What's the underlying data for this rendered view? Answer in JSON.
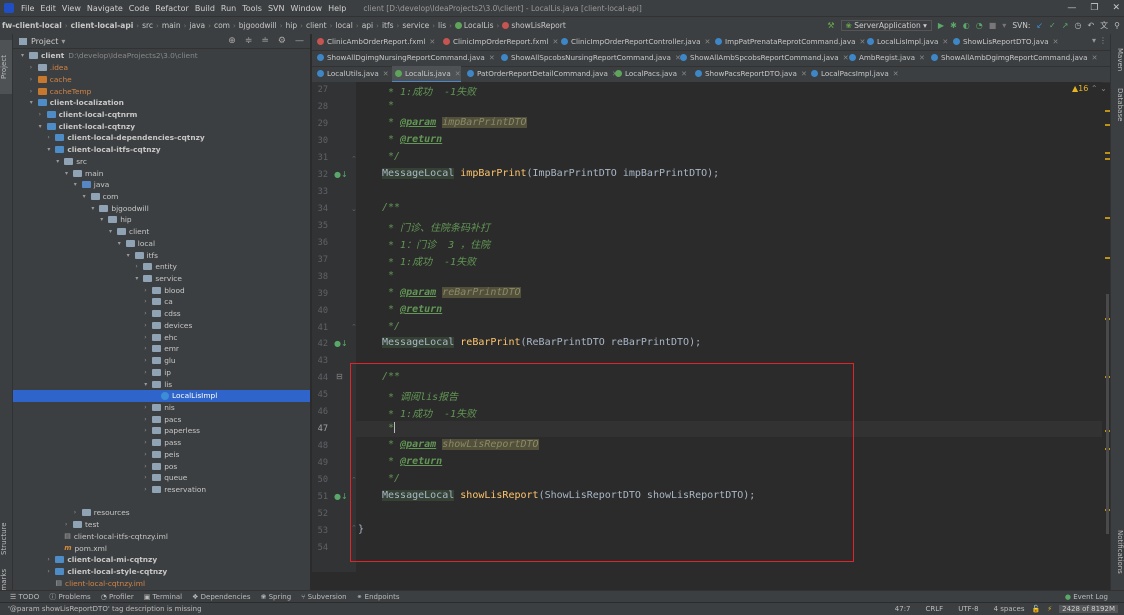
{
  "menubar": {
    "items": [
      "File",
      "Edit",
      "View",
      "Navigate",
      "Code",
      "Refactor",
      "Build",
      "Run",
      "Tools",
      "SVN",
      "Window",
      "Help"
    ],
    "window_title": "client [D:\\develop\\IdeaProjects2\\3.0\\client] - LocalLis.java [client-local-api]"
  },
  "navbar": {
    "crumbs": [
      "fw-client-local",
      "client-local-api",
      "src",
      "main",
      "java",
      "com",
      "bjgoodwill",
      "hip",
      "client",
      "local",
      "api",
      "itfs",
      "service",
      "lis",
      "LocalLis",
      "showLisReport"
    ],
    "run_config": "ServerApplication",
    "svn_label": "SVN:"
  },
  "project": {
    "title": "Project",
    "tree": [
      {
        "label": "client",
        "extra": "D:\\develop\\IdeaProjects2\\3.0\\client",
        "indent": 0,
        "arrow": "▾",
        "icon": "folder",
        "style": "bold"
      },
      {
        "label": ".idea",
        "indent": 1,
        "arrow": "›",
        "icon": "folder",
        "style": "orange"
      },
      {
        "label": "cache",
        "indent": 1,
        "arrow": "›",
        "icon": "folder orange",
        "style": "orange"
      },
      {
        "label": "cacheTemp",
        "indent": 1,
        "arrow": "›",
        "icon": "folder orange",
        "style": "orange"
      },
      {
        "label": "client-localization",
        "indent": 1,
        "arrow": "▾",
        "icon": "folder blue",
        "style": "bold"
      },
      {
        "label": "client-local-cqtnrm",
        "indent": 2,
        "arrow": "›",
        "icon": "folder blue",
        "style": "bold"
      },
      {
        "label": "client-local-cqtnzy",
        "indent": 2,
        "arrow": "▾",
        "icon": "folder blue",
        "style": "bold"
      },
      {
        "label": "client-local-dependencies-cqtnzy",
        "indent": 3,
        "arrow": "›",
        "icon": "folder blue",
        "style": "bold"
      },
      {
        "label": "client-local-itfs-cqtnzy",
        "indent": 3,
        "arrow": "▾",
        "icon": "folder blue",
        "style": "bold"
      },
      {
        "label": "src",
        "indent": 4,
        "arrow": "▾",
        "icon": "folder",
        "style": ""
      },
      {
        "label": "main",
        "indent": 5,
        "arrow": "▾",
        "icon": "folder",
        "style": ""
      },
      {
        "label": "java",
        "indent": 6,
        "arrow": "▾",
        "icon": "folder src",
        "style": ""
      },
      {
        "label": "com",
        "indent": 7,
        "arrow": "▾",
        "icon": "folder",
        "style": ""
      },
      {
        "label": "bjgoodwill",
        "indent": 8,
        "arrow": "▾",
        "icon": "folder",
        "style": ""
      },
      {
        "label": "hip",
        "indent": 9,
        "arrow": "▾",
        "icon": "folder",
        "style": ""
      },
      {
        "label": "client",
        "indent": 10,
        "arrow": "▾",
        "icon": "folder",
        "style": ""
      },
      {
        "label": "local",
        "indent": 11,
        "arrow": "▾",
        "icon": "folder",
        "style": ""
      },
      {
        "label": "itfs",
        "indent": 12,
        "arrow": "▾",
        "icon": "folder",
        "style": ""
      },
      {
        "label": "entity",
        "indent": 13,
        "arrow": "›",
        "icon": "folder",
        "style": ""
      },
      {
        "label": "service",
        "indent": 13,
        "arrow": "▾",
        "icon": "folder",
        "style": ""
      },
      {
        "label": "blood",
        "indent": 14,
        "arrow": "›",
        "icon": "folder",
        "style": ""
      },
      {
        "label": "ca",
        "indent": 14,
        "arrow": "›",
        "icon": "folder",
        "style": ""
      },
      {
        "label": "cdss",
        "indent": 14,
        "arrow": "›",
        "icon": "folder",
        "style": ""
      },
      {
        "label": "devices",
        "indent": 14,
        "arrow": "›",
        "icon": "folder",
        "style": ""
      },
      {
        "label": "ehc",
        "indent": 14,
        "arrow": "›",
        "icon": "folder",
        "style": ""
      },
      {
        "label": "emr",
        "indent": 14,
        "arrow": "›",
        "icon": "folder",
        "style": ""
      },
      {
        "label": "glu",
        "indent": 14,
        "arrow": "›",
        "icon": "folder",
        "style": ""
      },
      {
        "label": "ip",
        "indent": 14,
        "arrow": "›",
        "icon": "folder",
        "style": ""
      },
      {
        "label": "lis",
        "indent": 14,
        "arrow": "▾",
        "icon": "folder",
        "style": ""
      },
      {
        "label": "LocalLisImpl",
        "indent": 15,
        "arrow": "",
        "icon": "file",
        "style": "sel"
      },
      {
        "label": "nis",
        "indent": 14,
        "arrow": "›",
        "icon": "folder",
        "style": ""
      },
      {
        "label": "pacs",
        "indent": 14,
        "arrow": "›",
        "icon": "folder",
        "style": ""
      },
      {
        "label": "paperless",
        "indent": 14,
        "arrow": "›",
        "icon": "folder",
        "style": ""
      },
      {
        "label": "pass",
        "indent": 14,
        "arrow": "›",
        "icon": "folder",
        "style": ""
      },
      {
        "label": "peis",
        "indent": 14,
        "arrow": "›",
        "icon": "folder",
        "style": ""
      },
      {
        "label": "pos",
        "indent": 14,
        "arrow": "›",
        "icon": "folder",
        "style": ""
      },
      {
        "label": "queue",
        "indent": 14,
        "arrow": "›",
        "icon": "folder",
        "style": ""
      },
      {
        "label": "reservation",
        "indent": 14,
        "arrow": "›",
        "icon": "folder",
        "style": ""
      },
      {
        "label": "",
        "indent": 0,
        "arrow": "",
        "icon": "none",
        "style": ""
      },
      {
        "label": "resources",
        "indent": 6,
        "arrow": "›",
        "icon": "folder",
        "style": ""
      },
      {
        "label": "test",
        "indent": 5,
        "arrow": "›",
        "icon": "folder",
        "style": ""
      },
      {
        "label": "client-local-itfs-cqtnzy.iml",
        "indent": 4,
        "arrow": "",
        "icon": "iml",
        "style": ""
      },
      {
        "label": "pom.xml",
        "indent": 4,
        "arrow": "",
        "icon": "xml",
        "style": ""
      },
      {
        "label": "client-local-mi-cqtnzy",
        "indent": 3,
        "arrow": "›",
        "icon": "folder blue",
        "style": "bold"
      },
      {
        "label": "client-local-style-cqtnzy",
        "indent": 3,
        "arrow": "›",
        "icon": "folder blue",
        "style": "bold"
      },
      {
        "label": "client-local-cqtnzy.iml",
        "indent": 3,
        "arrow": "",
        "icon": "iml",
        "style": "orange"
      },
      {
        "label": "pom.xml",
        "indent": 3,
        "arrow": "",
        "icon": "xml",
        "style": ""
      }
    ]
  },
  "tabs": {
    "row1": [
      "ClinicAmbOrderReport.fxml",
      "ClinicImpOrderReport.fxml",
      "ClinicImpOrderReportController.java",
      "ImpPatPrenataReprotCommand.java",
      "LocalLisImpl.java",
      "ShowLisReportDTO.java"
    ],
    "row2": [
      "ShowAllDgimgNursingReportCommand.java",
      "ShowAllSpcobsNursingReportCommand.java",
      "ShowAllAmbSpcobsReportCommand.java",
      "AmbRegist.java",
      "ShowAllAmbDgimgReportCommand.java"
    ],
    "row3": [
      "LocalUtils.java",
      "LocalLis.java",
      "PatOrderReportDetailCommand.java",
      "LocalPacs.java",
      "ShowPacsReportDTO.java",
      "LocalPacsImpl.java"
    ],
    "active": "LocalLis.java"
  },
  "editor": {
    "warning_count": "16",
    "line_numbers": [
      "27",
      "28",
      "29",
      "30",
      "31",
      "32",
      "33",
      "34",
      "35",
      "36",
      "37",
      "38",
      "39",
      "40",
      "41",
      "42",
      "43",
      "44",
      "45",
      "46",
      "47",
      "48",
      "49",
      "50",
      "51",
      "52",
      "53",
      "54"
    ],
    "current_line": "47",
    "lines": {
      "l27": " * 1:成功  -1失败",
      "l28": " *",
      "l29_tag": "@param",
      "l29_param": "impBarPrintDTO",
      "l30_tag": "@return",
      "l31": " */",
      "l32_type": "MessageLocal",
      "l32_meth": "impBarPrint",
      "l32_rest": "(ImpBarPrintDTO impBarPrintDTO);",
      "l34": "/**",
      "l35": " * 门诊、住院条码补打",
      "l36": " * 1：门诊  3 ，住院",
      "l37": " * 1:成功  -1失败",
      "l38": " *",
      "l39_tag": "@param",
      "l39_param": "reBarPrintDTO",
      "l40_tag": "@return",
      "l41": " */",
      "l42_type": "MessageLocal",
      "l42_meth": "reBarPrint",
      "l42_rest": "(ReBarPrintDTO reBarPrintDTO);",
      "l44": "/**",
      "l45": " * 调阅lis报告",
      "l46": " * 1:成功  -1失败",
      "l47": " *",
      "l48_tag": "@param",
      "l48_param": "showLisReportDTO",
      "l49_tag": "@return",
      "l50": " */",
      "l51_type": "MessageLocal",
      "l51_meth": "showLisReport",
      "l51_rest": "(ShowLisReportDTO showLisReportDTO);",
      "l53": "}"
    }
  },
  "bottom_tools": [
    "TODO",
    "Problems",
    "Profiler",
    "Terminal",
    "Dependencies",
    "Spring",
    "Subversion",
    "Endpoints",
    "Event Log"
  ],
  "sidebar_left": [
    "Project",
    "Structure",
    "Bookmarks"
  ],
  "sidebar_right": [
    "Maven",
    "Database",
    "Notifications"
  ],
  "status": {
    "message": "'@param showLisReportDTO' tag description is missing",
    "position": "47:7",
    "line_sep": "CRLF",
    "encoding": "UTF-8",
    "indent": "4 spaces",
    "memory": "2428 of 8192M"
  },
  "colors": {
    "selection": "#2f65ca",
    "highlight_box": "#e0242a",
    "keyword_doc": "#629755",
    "method": "#ffc66d"
  }
}
